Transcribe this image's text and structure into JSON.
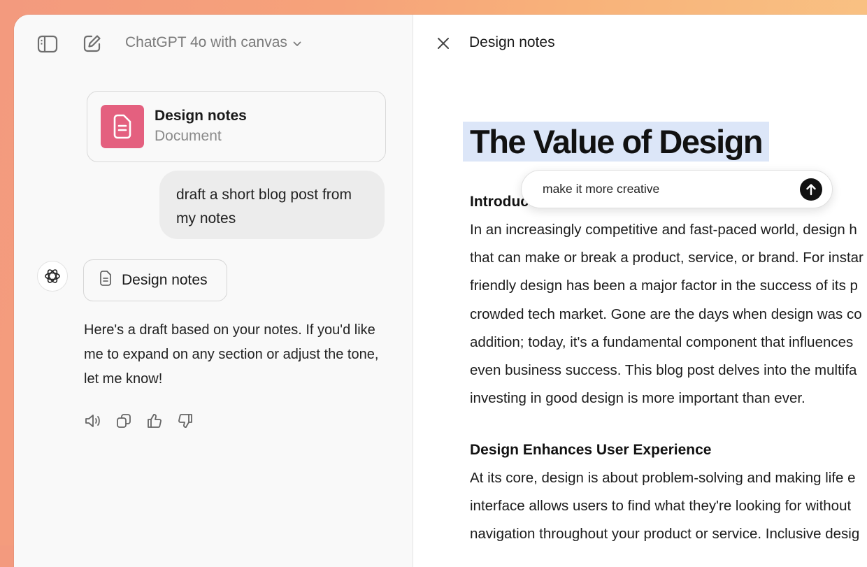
{
  "header": {
    "model_label": "ChatGPT 4o with canvas"
  },
  "chat": {
    "doc_card": {
      "title": "Design notes",
      "type": "Document"
    },
    "user_message": {
      "line1": "draft a short blog post from",
      "line2": "my notes"
    },
    "doc_chip_label": "Design notes",
    "assistant_message": {
      "line1": "Here's a draft based on your notes. If you'd like",
      "line2": "me to expand on any section or adjust the tone,",
      "line3": "let me know!"
    }
  },
  "canvas": {
    "title": "Design notes",
    "heading": "The Value of Design",
    "intro_heading": "Introduc",
    "intro_lines": [
      "In an increasingly competitive and fast-paced world, design h",
      "that can make or break a product, service, or brand. For instar",
      "friendly design has been a major factor in the success of its p",
      "crowded tech market. Gone are the days when design was co",
      "addition; today, it's a fundamental component that influences",
      "even business success. This blog post delves into the multifa",
      "investing in good design is more important than ever."
    ],
    "section2_heading": "Design Enhances User Experience",
    "section2_lines": [
      "At its core, design is about problem-solving and making life e",
      "interface allows users to find what they're looking for without",
      "navigation throughout your product or service. Inclusive desig"
    ],
    "prompt_text": "make it more creative"
  },
  "colors": {
    "doc_icon_bg": "#e4607f",
    "highlight": "#dce6f8",
    "send_button": "#111111"
  }
}
